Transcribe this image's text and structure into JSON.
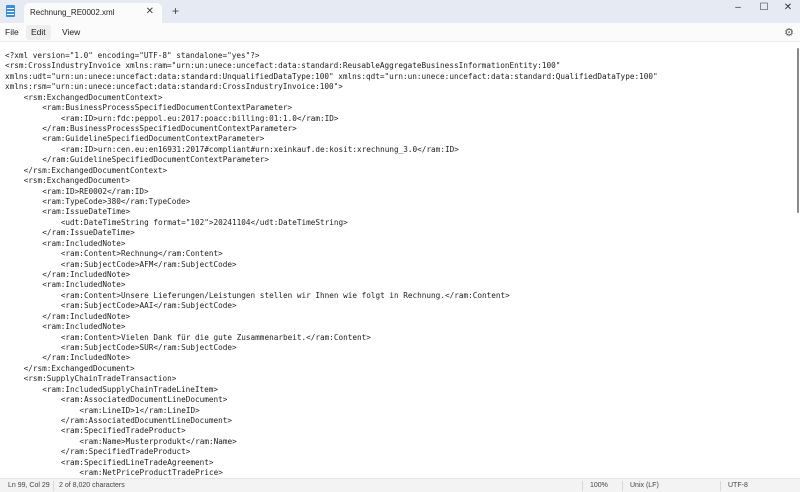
{
  "window": {
    "tab_title": "Rechnung_RE0002.xml",
    "close": "✕",
    "new_tab": "+",
    "minimize": "–",
    "maximize": "☐",
    "close_window": "✕"
  },
  "menu": {
    "file": "File",
    "edit": "Edit",
    "view": "View",
    "settings_icon": "⚙"
  },
  "editor": {
    "lines": [
      {
        "i": 0,
        "t": "<?xml version=\"1.0\" encoding=\"UTF-8\" standalone=\"yes\"?>"
      },
      {
        "i": 0,
        "t": "<rsm:CrossIndustryInvoice xmlns:ram=\"urn:un:unece:uncefact:data:standard:ReusableAggregateBusinessInformationEntity:100\""
      },
      {
        "i": 0,
        "t": "xmlns:udt=\"urn:un:unece:uncefact:data:standard:UnqualifiedDataType:100\" xmlns:qdt=\"urn:un:unece:uncefact:data:standard:QualifiedDataType:100\""
      },
      {
        "i": 0,
        "t": "xmlns:rsm=\"urn:un:unece:uncefact:data:standard:CrossIndustryInvoice:100\">"
      },
      {
        "i": 1,
        "t": "<rsm:ExchangedDocumentContext>"
      },
      {
        "i": 2,
        "t": "<ram:BusinessProcessSpecifiedDocumentContextParameter>"
      },
      {
        "i": 3,
        "t": "<ram:ID>urn:fdc:peppol.eu:2017:poacc:billing:01:1.0</ram:ID>"
      },
      {
        "i": 2,
        "t": "</ram:BusinessProcessSpecifiedDocumentContextParameter>"
      },
      {
        "i": 2,
        "t": "<ram:GuidelineSpecifiedDocumentContextParameter>"
      },
      {
        "i": 3,
        "t": "<ram:ID>urn:cen.eu:en16931:2017#compliant#urn:xeinkauf.de:kosit:xrechnung_3.0</ram:ID>"
      },
      {
        "i": 2,
        "t": "</ram:GuidelineSpecifiedDocumentContextParameter>"
      },
      {
        "i": 1,
        "t": "</rsm:ExchangedDocumentContext>"
      },
      {
        "i": 1,
        "t": "<rsm:ExchangedDocument>"
      },
      {
        "i": 2,
        "t": "<ram:ID>RE0002</ram:ID>"
      },
      {
        "i": 2,
        "t": "<ram:TypeCode>380</ram:TypeCode>"
      },
      {
        "i": 2,
        "t": "<ram:IssueDateTime>"
      },
      {
        "i": 3,
        "t": "<udt:DateTimeString format=\"102\">20241104</udt:DateTimeString>"
      },
      {
        "i": 2,
        "t": "</ram:IssueDateTime>"
      },
      {
        "i": 2,
        "t": "<ram:IncludedNote>"
      },
      {
        "i": 3,
        "t": "<ram:Content>Rechnung</ram:Content>"
      },
      {
        "i": 3,
        "t": "<ram:SubjectCode>AFM</ram:SubjectCode>"
      },
      {
        "i": 2,
        "t": "</ram:IncludedNote>"
      },
      {
        "i": 2,
        "t": "<ram:IncludedNote>"
      },
      {
        "i": 3,
        "t": "<ram:Content>Unsere Lieferungen/Leistungen stellen wir Ihnen wie folgt in Rechnung.</ram:Content>"
      },
      {
        "i": 3,
        "t": "<ram:SubjectCode>AAI</ram:SubjectCode>"
      },
      {
        "i": 2,
        "t": "</ram:IncludedNote>"
      },
      {
        "i": 2,
        "t": "<ram:IncludedNote>"
      },
      {
        "i": 3,
        "t": "<ram:Content>Vielen Dank für die gute Zusammenarbeit.</ram:Content>"
      },
      {
        "i": 3,
        "t": "<ram:SubjectCode>SUR</ram:SubjectCode>"
      },
      {
        "i": 2,
        "t": "</ram:IncludedNote>"
      },
      {
        "i": 1,
        "t": "</rsm:ExchangedDocument>"
      },
      {
        "i": 1,
        "t": "<rsm:SupplyChainTradeTransaction>"
      },
      {
        "i": 2,
        "t": "<ram:IncludedSupplyChainTradeLineItem>"
      },
      {
        "i": 3,
        "t": "<ram:AssociatedDocumentLineDocument>"
      },
      {
        "i": 4,
        "t": "<ram:LineID>1</ram:LineID>"
      },
      {
        "i": 3,
        "t": "</ram:AssociatedDocumentLineDocument>"
      },
      {
        "i": 3,
        "t": "<ram:SpecifiedTradeProduct>"
      },
      {
        "i": 4,
        "t": "<ram:Name>Musterprodukt</ram:Name>"
      },
      {
        "i": 3,
        "t": "</ram:SpecifiedTradeProduct>"
      },
      {
        "i": 3,
        "t": "<ram:SpecifiedLineTradeAgreement>"
      },
      {
        "i": 4,
        "t": "<ram:NetPriceProductTradePrice>"
      }
    ]
  },
  "status": {
    "position": "Ln 99, Col 29",
    "selection": "2 of 8,020 characters",
    "zoom": "100%",
    "line_ending": "Unix (LF)",
    "encoding": "UTF-8"
  }
}
